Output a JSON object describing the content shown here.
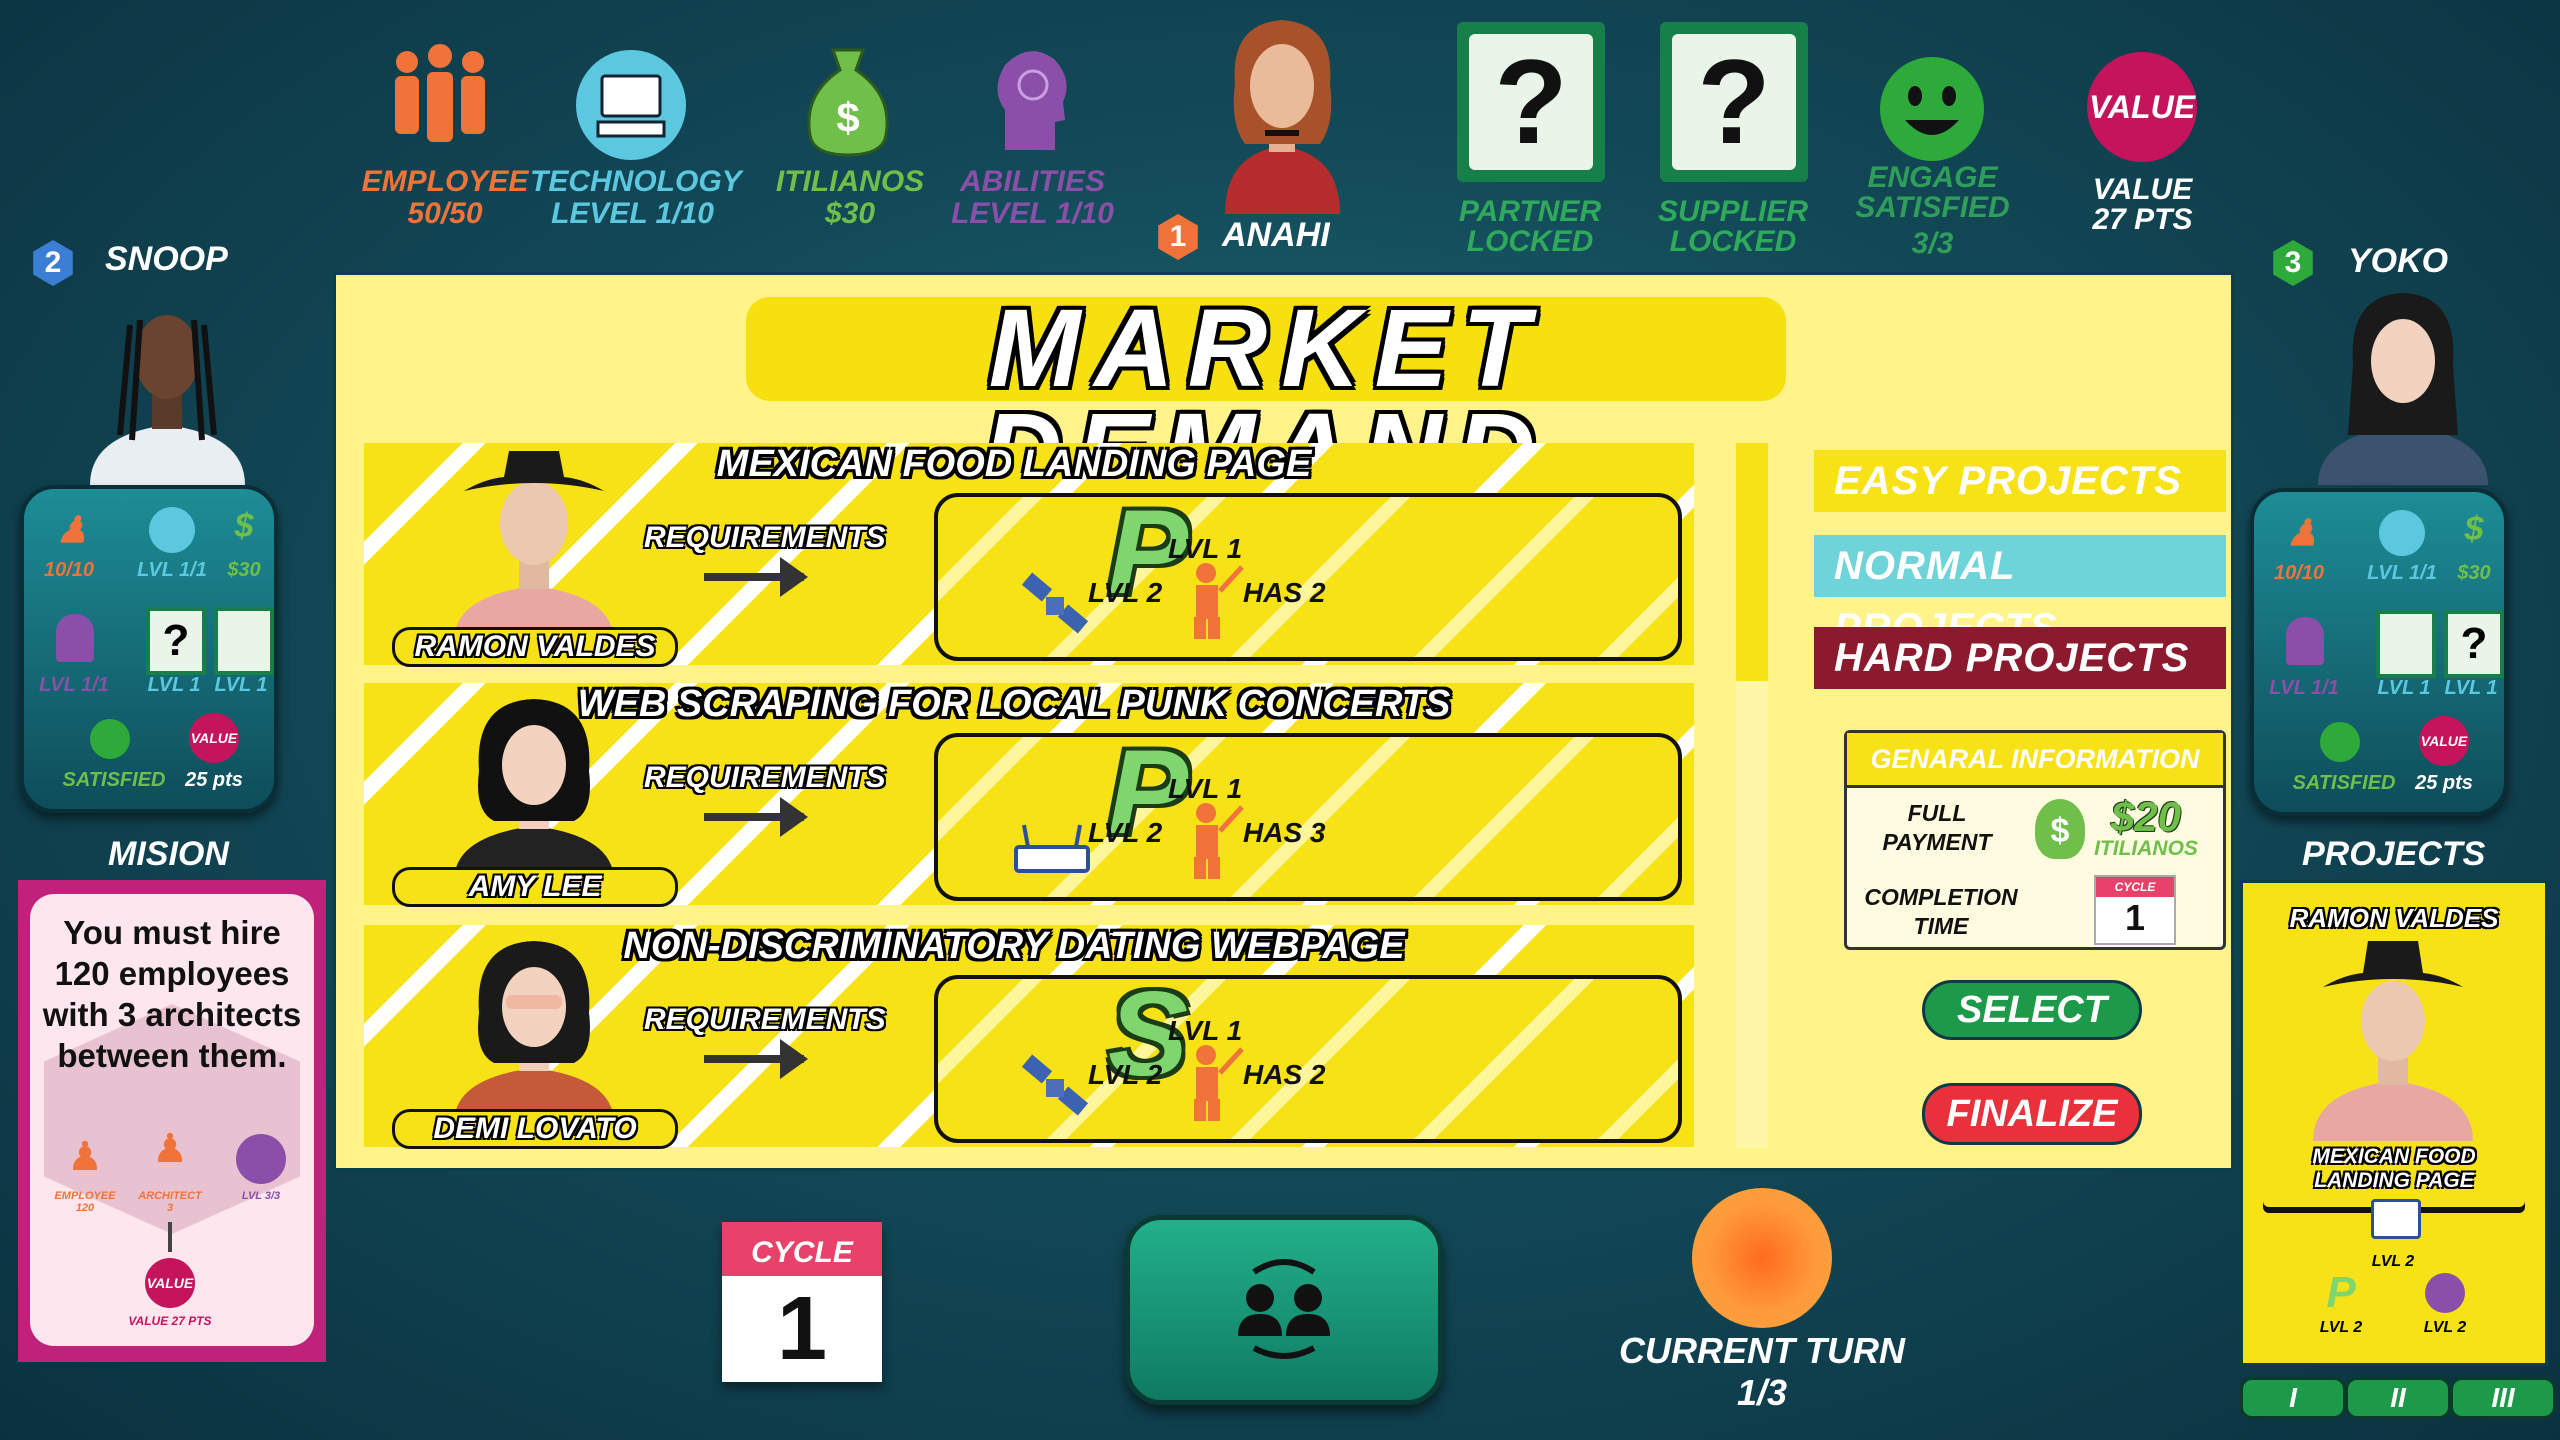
{
  "top_stats": {
    "employee": {
      "label": "EMPLOYEE",
      "value": "50/50"
    },
    "technology": {
      "label": "TECHNOLOGY",
      "value": "LEVEL 1/10"
    },
    "itilianos": {
      "label": "ITILIANOS",
      "value": "$30"
    },
    "abilities": {
      "label": "ABILITIES",
      "value": "LEVEL 1/10"
    },
    "partner": {
      "label": "PARTNER",
      "value": "LOCKED"
    },
    "supplier": {
      "label": "SUPPLIER",
      "value": "LOCKED"
    },
    "engage": {
      "label": "ENGAGE",
      "value": "SATISFIED",
      "count": "3/3"
    },
    "value": {
      "badge": "VALUE",
      "label": "VALUE",
      "value": "27 PTS"
    }
  },
  "current_player": {
    "number": "1",
    "name": "ANAHI"
  },
  "left_player": {
    "number": "2",
    "name": "SNOOP",
    "stats": {
      "employees": "10/10",
      "tech": "LVL 1/1",
      "money": "$30",
      "abilities": "LVL 1/1",
      "partner": "LVL 1",
      "supplier": "LVL 1",
      "satisfied": "SATISFIED",
      "value_badge": "VALUE",
      "value": "25 pts"
    }
  },
  "right_player": {
    "number": "3",
    "name": "YOKO",
    "stats": {
      "employees": "10/10",
      "tech": "LVL 1/1",
      "money": "$30",
      "abilities": "LVL 1/1",
      "partner": "LVL 1",
      "supplier": "LVL 1",
      "satisfied": "SATISFIED",
      "value_badge": "VALUE",
      "value": "25 pts"
    }
  },
  "mission": {
    "heading": "MISION",
    "text": "You must hire 120 employees with 3 architects between them.",
    "employee_label": "EMPLOYEE",
    "employee_count": "120",
    "architect_label": "ARCHITECT",
    "architect_count": "3",
    "level_label": "LVL 3/3",
    "value_badge": "VALUE",
    "value_pts": "VALUE 27 PTS"
  },
  "board": {
    "title": "MARKET DEMAND",
    "requirements_label": "REQUIREMENTS",
    "projects": [
      {
        "title": "MEXICAN FOOD LANDING PAGE",
        "client": "RAMON VALDES",
        "letter": "P",
        "letter_lvl": "LVL 1",
        "tech_lvl": "LVL 2",
        "has": "HAS 2"
      },
      {
        "title": "WEB SCRAPING FOR LOCAL PUNK CONCERTS",
        "client": "AMY LEE",
        "letter": "P",
        "letter_lvl": "LVL 1",
        "tech_lvl": "LVL 2",
        "has": "HAS 3"
      },
      {
        "title": "NON-DISCRIMINATORY DATING WEBPAGE",
        "client": "DEMI LOVATO",
        "letter": "S",
        "letter_lvl": "LVL 1",
        "tech_lvl": "LVL 2",
        "has": "HAS 2"
      }
    ],
    "difficulty_buttons": {
      "easy": "EASY PROJECTS",
      "normal": "NORMAL PROJECTS",
      "hard": "HARD PROJECTS"
    },
    "general_info": {
      "heading": "GENARAL INFORMATION",
      "payment_label": "FULL PAYMENT",
      "payment_value": "$20",
      "payment_unit": "ITILIANOS",
      "completion_label": "COMPLETION TIME",
      "cycle_label": "CYCLE",
      "cycle_value": "1"
    },
    "select_label": "SELECT",
    "finalize_label": "FINALIZE"
  },
  "bottom": {
    "cycle_label": "CYCLE",
    "cycle_value": "1",
    "current_turn_label": "CURRENT TURN",
    "current_turn_value": "1/3"
  },
  "projects_panel": {
    "heading": "PROJECTS",
    "card_client": "RAMON VALDES",
    "card_title": "MEXICAN FOOD LANDING PAGE",
    "router_lvl": "LVL 2",
    "p_lvl": "LVL 2",
    "gear_lvl": "LVL 2",
    "pages": [
      "I",
      "II",
      "III"
    ]
  },
  "colors": {
    "board_bg": "#fff38a",
    "accent_yellow": "#f7e217",
    "easy": "#f7e217",
    "normal": "#6fd4d9",
    "hard": "#8b1a2e",
    "select": "#1c9a4a",
    "finalize": "#e8313a",
    "employee": "#f0733a",
    "technology": "#5cc8e0",
    "itilianos": "#6fbf4a",
    "abilities": "#8a4fa8"
  }
}
